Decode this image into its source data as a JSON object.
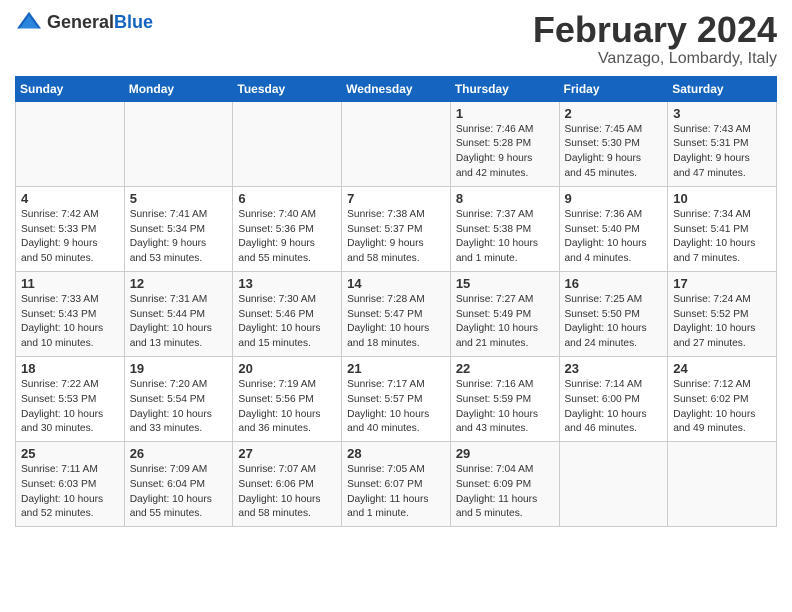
{
  "logo": {
    "general": "General",
    "blue": "Blue"
  },
  "title": "February 2024",
  "location": "Vanzago, Lombardy, Italy",
  "headers": [
    "Sunday",
    "Monday",
    "Tuesday",
    "Wednesday",
    "Thursday",
    "Friday",
    "Saturday"
  ],
  "weeks": [
    [
      {
        "day": "",
        "info": ""
      },
      {
        "day": "",
        "info": ""
      },
      {
        "day": "",
        "info": ""
      },
      {
        "day": "",
        "info": ""
      },
      {
        "day": "1",
        "info": "Sunrise: 7:46 AM\nSunset: 5:28 PM\nDaylight: 9 hours\nand 42 minutes."
      },
      {
        "day": "2",
        "info": "Sunrise: 7:45 AM\nSunset: 5:30 PM\nDaylight: 9 hours\nand 45 minutes."
      },
      {
        "day": "3",
        "info": "Sunrise: 7:43 AM\nSunset: 5:31 PM\nDaylight: 9 hours\nand 47 minutes."
      }
    ],
    [
      {
        "day": "4",
        "info": "Sunrise: 7:42 AM\nSunset: 5:33 PM\nDaylight: 9 hours\nand 50 minutes."
      },
      {
        "day": "5",
        "info": "Sunrise: 7:41 AM\nSunset: 5:34 PM\nDaylight: 9 hours\nand 53 minutes."
      },
      {
        "day": "6",
        "info": "Sunrise: 7:40 AM\nSunset: 5:36 PM\nDaylight: 9 hours\nand 55 minutes."
      },
      {
        "day": "7",
        "info": "Sunrise: 7:38 AM\nSunset: 5:37 PM\nDaylight: 9 hours\nand 58 minutes."
      },
      {
        "day": "8",
        "info": "Sunrise: 7:37 AM\nSunset: 5:38 PM\nDaylight: 10 hours\nand 1 minute."
      },
      {
        "day": "9",
        "info": "Sunrise: 7:36 AM\nSunset: 5:40 PM\nDaylight: 10 hours\nand 4 minutes."
      },
      {
        "day": "10",
        "info": "Sunrise: 7:34 AM\nSunset: 5:41 PM\nDaylight: 10 hours\nand 7 minutes."
      }
    ],
    [
      {
        "day": "11",
        "info": "Sunrise: 7:33 AM\nSunset: 5:43 PM\nDaylight: 10 hours\nand 10 minutes."
      },
      {
        "day": "12",
        "info": "Sunrise: 7:31 AM\nSunset: 5:44 PM\nDaylight: 10 hours\nand 13 minutes."
      },
      {
        "day": "13",
        "info": "Sunrise: 7:30 AM\nSunset: 5:46 PM\nDaylight: 10 hours\nand 15 minutes."
      },
      {
        "day": "14",
        "info": "Sunrise: 7:28 AM\nSunset: 5:47 PM\nDaylight: 10 hours\nand 18 minutes."
      },
      {
        "day": "15",
        "info": "Sunrise: 7:27 AM\nSunset: 5:49 PM\nDaylight: 10 hours\nand 21 minutes."
      },
      {
        "day": "16",
        "info": "Sunrise: 7:25 AM\nSunset: 5:50 PM\nDaylight: 10 hours\nand 24 minutes."
      },
      {
        "day": "17",
        "info": "Sunrise: 7:24 AM\nSunset: 5:52 PM\nDaylight: 10 hours\nand 27 minutes."
      }
    ],
    [
      {
        "day": "18",
        "info": "Sunrise: 7:22 AM\nSunset: 5:53 PM\nDaylight: 10 hours\nand 30 minutes."
      },
      {
        "day": "19",
        "info": "Sunrise: 7:20 AM\nSunset: 5:54 PM\nDaylight: 10 hours\nand 33 minutes."
      },
      {
        "day": "20",
        "info": "Sunrise: 7:19 AM\nSunset: 5:56 PM\nDaylight: 10 hours\nand 36 minutes."
      },
      {
        "day": "21",
        "info": "Sunrise: 7:17 AM\nSunset: 5:57 PM\nDaylight: 10 hours\nand 40 minutes."
      },
      {
        "day": "22",
        "info": "Sunrise: 7:16 AM\nSunset: 5:59 PM\nDaylight: 10 hours\nand 43 minutes."
      },
      {
        "day": "23",
        "info": "Sunrise: 7:14 AM\nSunset: 6:00 PM\nDaylight: 10 hours\nand 46 minutes."
      },
      {
        "day": "24",
        "info": "Sunrise: 7:12 AM\nSunset: 6:02 PM\nDaylight: 10 hours\nand 49 minutes."
      }
    ],
    [
      {
        "day": "25",
        "info": "Sunrise: 7:11 AM\nSunset: 6:03 PM\nDaylight: 10 hours\nand 52 minutes."
      },
      {
        "day": "26",
        "info": "Sunrise: 7:09 AM\nSunset: 6:04 PM\nDaylight: 10 hours\nand 55 minutes."
      },
      {
        "day": "27",
        "info": "Sunrise: 7:07 AM\nSunset: 6:06 PM\nDaylight: 10 hours\nand 58 minutes."
      },
      {
        "day": "28",
        "info": "Sunrise: 7:05 AM\nSunset: 6:07 PM\nDaylight: 11 hours\nand 1 minute."
      },
      {
        "day": "29",
        "info": "Sunrise: 7:04 AM\nSunset: 6:09 PM\nDaylight: 11 hours\nand 5 minutes."
      },
      {
        "day": "",
        "info": ""
      },
      {
        "day": "",
        "info": ""
      }
    ]
  ]
}
